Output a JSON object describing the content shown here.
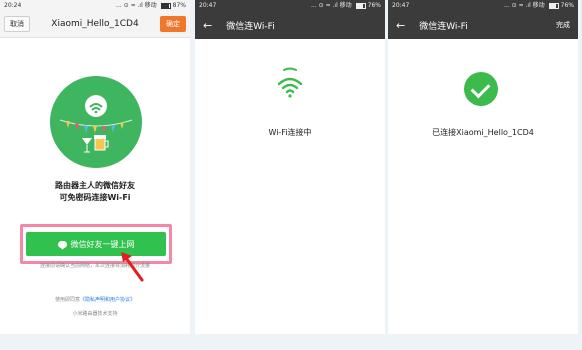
{
  "screen1": {
    "status": {
      "time": "20:24",
      "icons": "... ⊙ ≈ .ıl 移动",
      "battery": "87%"
    },
    "header": {
      "cancel": "取消",
      "title": "Xiaomi_Hello_1CD4",
      "confirm": "确定"
    },
    "headline_line1": "路由器主人的微信好友",
    "headline_line2": "可免密码连接Wi-Fi",
    "cta_label": "微信好友一键上网",
    "fine_print": "连接前请确认当前网络，本次连接将消耗部分流量",
    "terms_prefix": "使用即同意",
    "terms_link": "《隐私声明和用户协议》",
    "tech_support": "小米路由器技术支持"
  },
  "screen2": {
    "status": {
      "time": "20:47",
      "icons": "... ⊙ ≈ .ıl 移动",
      "battery": "76%"
    },
    "header_title": "微信连Wi-Fi",
    "message": "Wi-Fi连接中"
  },
  "screen3": {
    "status": {
      "time": "20:47",
      "icons": "... ⊙ ≈ .ıl 移动",
      "battery": "76%"
    },
    "header_title": "微信连Wi-Fi",
    "done": "完成",
    "message": "已连接Xiaomi_Hello_1CD4"
  },
  "colors": {
    "brand_green": "#3fb55f",
    "cta_green": "#31c14e",
    "confirm_orange": "#f0782c",
    "highlight_pink": "#f288a6",
    "arrow_red": "#e02020"
  }
}
